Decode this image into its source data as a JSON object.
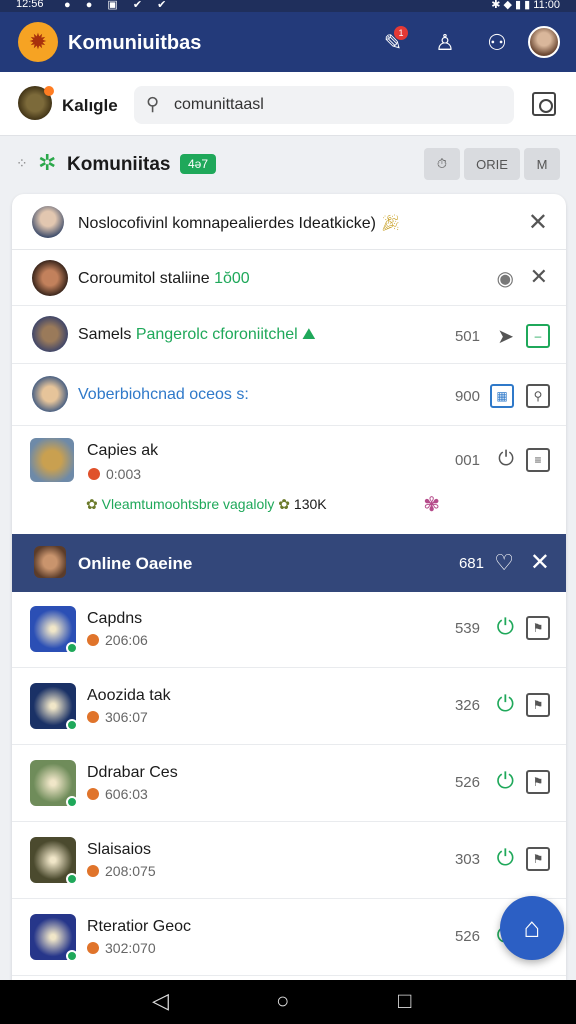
{
  "status_bar": {
    "time": "12:56",
    "right_time": "11:00",
    "left_icons": "● ● ▣ ✔ ✔",
    "right_icons": "✱ ◆ ▮ ▮"
  },
  "app_bar": {
    "title": "Komuniuitbas",
    "notification_count": "1"
  },
  "search_bar": {
    "user_name": "Kalıgle",
    "search_value": "comunittaasl",
    "search_placeholder": "comunittaasl"
  },
  "section": {
    "title": "Komuniitas",
    "count_badge": "4ə7",
    "buttons": [
      "",
      "ORIE",
      "M"
    ]
  },
  "notice": {
    "text": "Noslocofivinl komnapealierdes Ideatkicke)"
  },
  "community_rows": [
    {
      "name": "Coroumitol staliine",
      "highlight": "1ŏ00",
      "count": ""
    },
    {
      "name": "Samels",
      "highlight": "Pangerolc cforoniitchel",
      "count": "501"
    },
    {
      "name": "",
      "highlight": "Voberbiohcnad oceos s:",
      "count": "900"
    },
    {
      "name": "Capies ak",
      "sub": "0:003",
      "count": "001",
      "extra": "Vleamtumoohtsbre vagaloly",
      "extra2": "130K"
    }
  ],
  "online": {
    "title": "Online Oaeine",
    "count": "681"
  },
  "games": [
    {
      "name": "Capdns",
      "time": "206:06",
      "count": "539",
      "color": "#2b4fb5"
    },
    {
      "name": "Aoozida tak",
      "time": "306:07",
      "count": "326",
      "color": "#1a3166"
    },
    {
      "name": "Ddrabar Ces",
      "time": "606:03",
      "count": "526",
      "color": "#6f8c5a"
    },
    {
      "name": "Slaisaios",
      "time": "208:075",
      "count": "303",
      "color": "#4b4a2e"
    },
    {
      "name": "Rteratior Geoc",
      "time": "302:070",
      "count": "526",
      "color": "#26368a"
    }
  ],
  "colors": {
    "primary": "#233a7a",
    "accent_green": "#1fa85a",
    "online_header": "#33477a",
    "fab": "#2c5fc4"
  }
}
